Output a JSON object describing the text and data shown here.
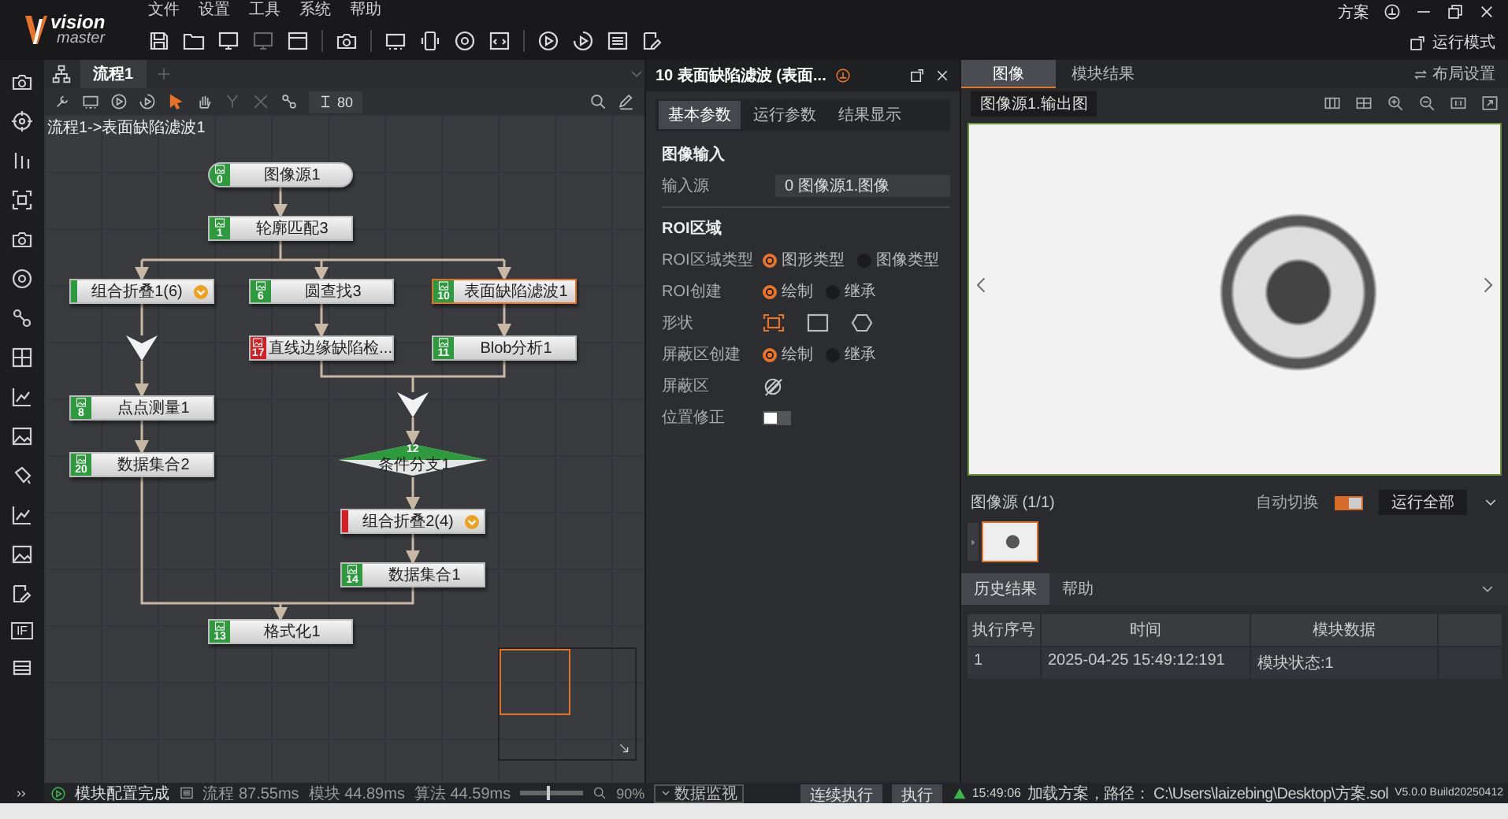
{
  "logo": {
    "top": "vision",
    "bottom": "master"
  },
  "menu": [
    {
      "label": "文件"
    },
    {
      "label": "设置"
    },
    {
      "label": "工具"
    },
    {
      "label": "系统"
    },
    {
      "label": "帮助"
    }
  ],
  "window_controls": {
    "scheme": "方案"
  },
  "run_mode_button": "运行模式",
  "sidebar": {
    "logic_label": "IF"
  },
  "flow_tabs": [
    {
      "label": "流程1",
      "selected": true
    }
  ],
  "flow_toolbar": {
    "spacing": "80"
  },
  "breadcrumb": "流程1->表面缺陷滤波1",
  "nodes": [
    {
      "label": "图像源1",
      "number": "0",
      "kind": "source",
      "failed": false,
      "selected": false
    },
    {
      "label": "轮廓匹配3",
      "number": "1",
      "kind": "module",
      "failed": false,
      "selected": false
    },
    {
      "label": "组合折叠1(6)",
      "kind": "group",
      "failed": false,
      "selected": false
    },
    {
      "label": "圆查找3",
      "number": "6",
      "kind": "module",
      "failed": false,
      "selected": false
    },
    {
      "label": "表面缺陷滤波1",
      "number": "10",
      "kind": "module",
      "failed": false,
      "selected": true
    },
    {
      "label": "直线边缘缺陷检...",
      "number": "17",
      "kind": "module",
      "failed": true,
      "selected": false
    },
    {
      "label": "Blob分析1",
      "number": "11",
      "kind": "module",
      "failed": false,
      "selected": false
    },
    {
      "label": "点点测量1",
      "number": "8",
      "kind": "module",
      "failed": false,
      "selected": false
    },
    {
      "label": "数据集合2",
      "number": "20",
      "kind": "module",
      "failed": false,
      "selected": false
    },
    {
      "label": "条件分支1",
      "number": "12",
      "kind": "branch",
      "failed": false,
      "selected": false
    },
    {
      "label": "组合折叠2(4)",
      "kind": "group",
      "failed": true,
      "selected": false
    },
    {
      "label": "数据集合1",
      "number": "14",
      "kind": "module",
      "failed": false,
      "selected": false
    },
    {
      "label": "格式化1",
      "number": "13",
      "kind": "module",
      "failed": false,
      "selected": false
    }
  ],
  "module_panel": {
    "title": "10 表面缺陷滤波 (表面...",
    "tabs": [
      {
        "label": "基本参数",
        "selected": true
      },
      {
        "label": "运行参数",
        "selected": false
      },
      {
        "label": "结果显示",
        "selected": false
      }
    ],
    "params": [
      {
        "kind": "section",
        "label": "图像输入"
      },
      {
        "kind": "select",
        "label": "输入源",
        "value": "0 图像源1.图像"
      },
      {
        "kind": "section",
        "label": "ROI区域"
      },
      {
        "kind": "radio",
        "label": "ROI区域类型",
        "options": [
          {
            "label": "图形类型",
            "selected": true
          },
          {
            "label": "图像类型",
            "selected": false
          }
        ]
      },
      {
        "kind": "radio",
        "label": "ROI创建",
        "options": [
          {
            "label": "绘制",
            "selected": true
          },
          {
            "label": "继承",
            "selected": false
          }
        ]
      },
      {
        "kind": "shapes",
        "label": "形状",
        "options": [
          {
            "kind": "frame",
            "selected": true
          },
          {
            "kind": "rectangle",
            "selected": false
          },
          {
            "kind": "hexagon",
            "selected": false
          }
        ]
      },
      {
        "kind": "radio",
        "label": "屏蔽区创建",
        "options": [
          {
            "label": "绘制",
            "selected": true
          },
          {
            "label": "继承",
            "selected": false
          }
        ]
      },
      {
        "kind": "icon",
        "label": "屏蔽区"
      },
      {
        "kind": "toggle",
        "label": "位置修正",
        "on": false
      }
    ]
  },
  "image_panel": {
    "tabs": [
      {
        "label": "图像",
        "selected": true
      },
      {
        "label": "模块结果",
        "selected": false
      }
    ],
    "layout_button": "布局设置",
    "image_select": "图像源1.输出图",
    "source_label": "图像源 (1/1)",
    "auto_switch": {
      "label": "自动切换",
      "on": true
    },
    "run_select": "运行全部"
  },
  "result_panel": {
    "tabs": [
      {
        "label": "历史结果",
        "selected": true
      },
      {
        "label": "帮助",
        "selected": false
      }
    ],
    "columns": [
      "执行序号",
      "时间",
      "模块数据"
    ],
    "rows": [
      [
        "1",
        "2025-04-25 15:49:12:191",
        "模块状态:1"
      ]
    ]
  },
  "status_bar": {
    "message": "模块配置完成",
    "metrics": [
      {
        "label": "流程",
        "value": "87.55ms"
      },
      {
        "label": "模块",
        "value": "44.89ms"
      },
      {
        "label": "算法",
        "value": "44.59ms"
      }
    ],
    "zoom_slider": {
      "level": 0.45
    },
    "zoom": "90%",
    "monitor_button": "数据监视",
    "buttons": [
      {
        "label": "连续执行"
      },
      {
        "label": "执行"
      }
    ]
  },
  "log": {
    "time": "15:49:06",
    "message": "加载方案，路径： C:\\Users\\laizebing\\Desktop\\方案.sol",
    "version": "V5.0.0 Build20250412"
  }
}
